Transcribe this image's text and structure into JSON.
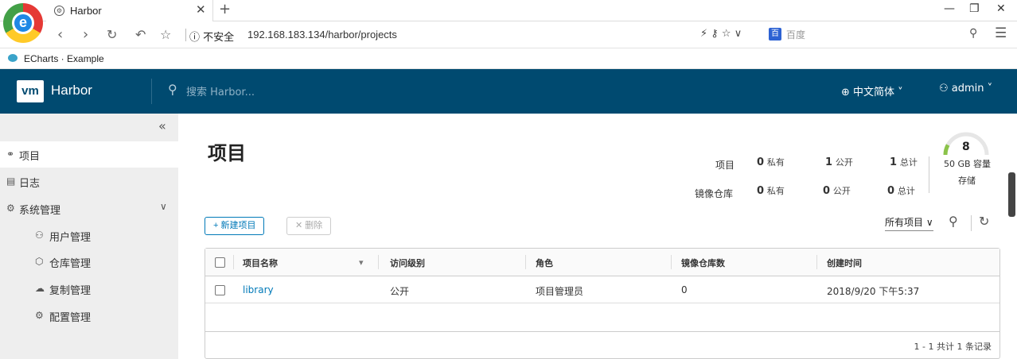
{
  "browser": {
    "tab_title": "Harbor",
    "tab_close": "✕",
    "new_tab": "+",
    "security": "ⓘ 不安全",
    "url": "192.168.183.134/harbor/projects",
    "search_engine": "百度",
    "bookmark": "ECharts · Example"
  },
  "header": {
    "logo": "vm",
    "brand": "Harbor",
    "search_placeholder": "搜索 Harbor...",
    "language": "中文简体",
    "user": "admin"
  },
  "sidebar": {
    "items": [
      {
        "label": "项目"
      },
      {
        "label": "日志"
      },
      {
        "label": "系统管理"
      },
      {
        "label": "用户管理"
      },
      {
        "label": "仓库管理"
      },
      {
        "label": "复制管理"
      },
      {
        "label": "配置管理"
      }
    ]
  },
  "main": {
    "title": "项目",
    "stats": {
      "projects_label": "项目",
      "repos_label": "镜像仓库",
      "projects": {
        "private": "0",
        "public": "1",
        "total": "1"
      },
      "repos": {
        "private": "0",
        "public": "0",
        "total": "0"
      },
      "private_label": "私有",
      "public_label": "公开",
      "total_label": "总计"
    },
    "storage": {
      "count": "8",
      "capacity": "50 GB 容量",
      "label": "存储",
      "fill_fraction": 0.16
    },
    "new_project_btn": "+ 新建项目",
    "delete_btn": "✕ 删除",
    "filter": "所有项目",
    "table": {
      "columns": [
        "项目名称",
        "访问级别",
        "角色",
        "镜像仓库数",
        "创建时间"
      ],
      "rows": [
        {
          "name": "library",
          "access": "公开",
          "role": "项目管理员",
          "repo_count": "0",
          "created": "2018/9/20 下午5:37"
        }
      ],
      "footer": "1 - 1 共计 1 条记录"
    }
  }
}
